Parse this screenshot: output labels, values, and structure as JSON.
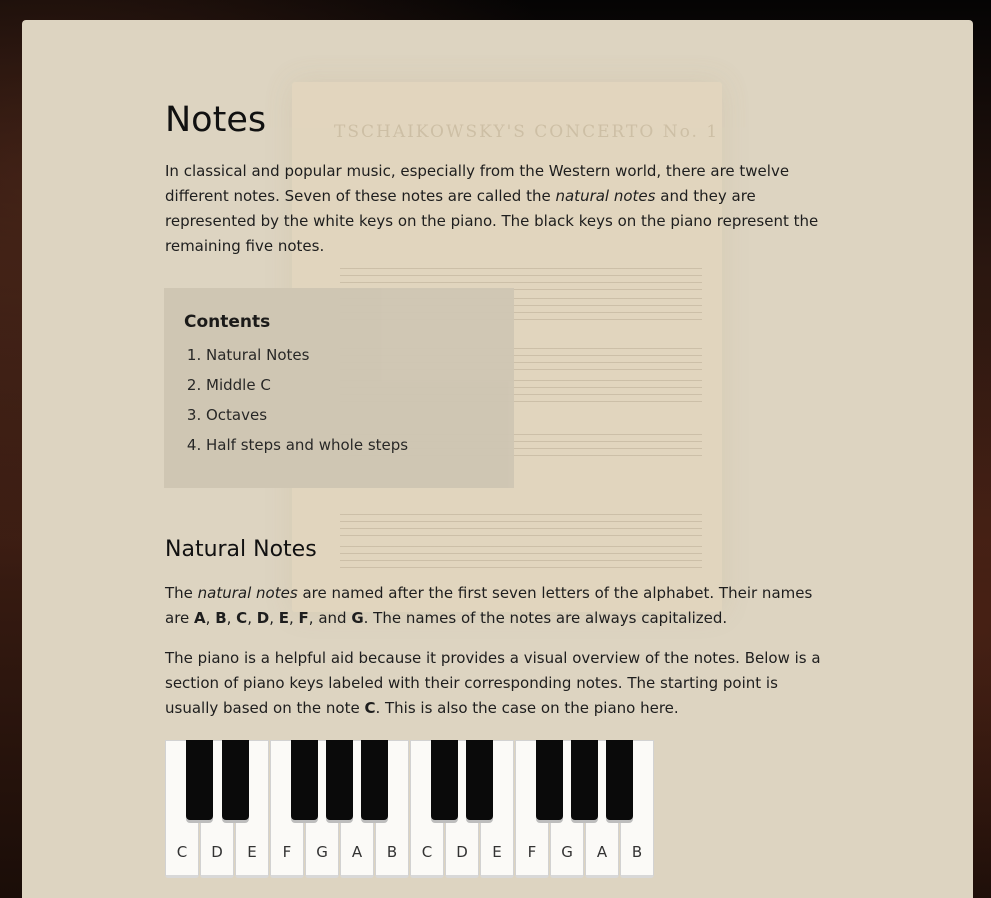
{
  "page": {
    "title": "Notes",
    "intro": {
      "p1": "In classical and popular music, especially from the Western world, there are twelve different notes. Seven of these notes are called the ",
      "em": "natural notes",
      "p2": " and they are represented by the white keys on the piano. The black keys on the piano represent the remaining five notes."
    },
    "background_sheet": {
      "title": "TSCHAIKOWSKY'S CONCERTO No. 1"
    }
  },
  "toc": {
    "title": "Contents",
    "items": [
      "Natural Notes",
      "Middle C",
      "Octaves",
      "Half steps and whole steps"
    ]
  },
  "natural_notes": {
    "heading": "Natural Notes",
    "para1": {
      "a": "The ",
      "em": "natural notes",
      "b": " are named after the first seven letters of the alphabet. Their names are ",
      "n1": "A",
      "s1": ", ",
      "n2": "B",
      "s2": ", ",
      "n3": "C",
      "s3": ", ",
      "n4": "D",
      "s4": ", ",
      "n5": "E",
      "s5": ", ",
      "n6": "F",
      "s6": ", and ",
      "n7": "G",
      "c": ". The names of the notes are always capitalized."
    },
    "para2": {
      "a": "The piano is a helpful aid because it provides a visual overview of the notes. Below is a section of piano keys labeled with their corresponding notes. The starting point is usually based on the note ",
      "b": "C",
      "c": ". This is also the case on the piano here."
    }
  },
  "piano": {
    "white_keys": [
      "C",
      "D",
      "E",
      "F",
      "G",
      "A",
      "B",
      "C",
      "D",
      "E",
      "F",
      "G",
      "A",
      "B"
    ]
  }
}
